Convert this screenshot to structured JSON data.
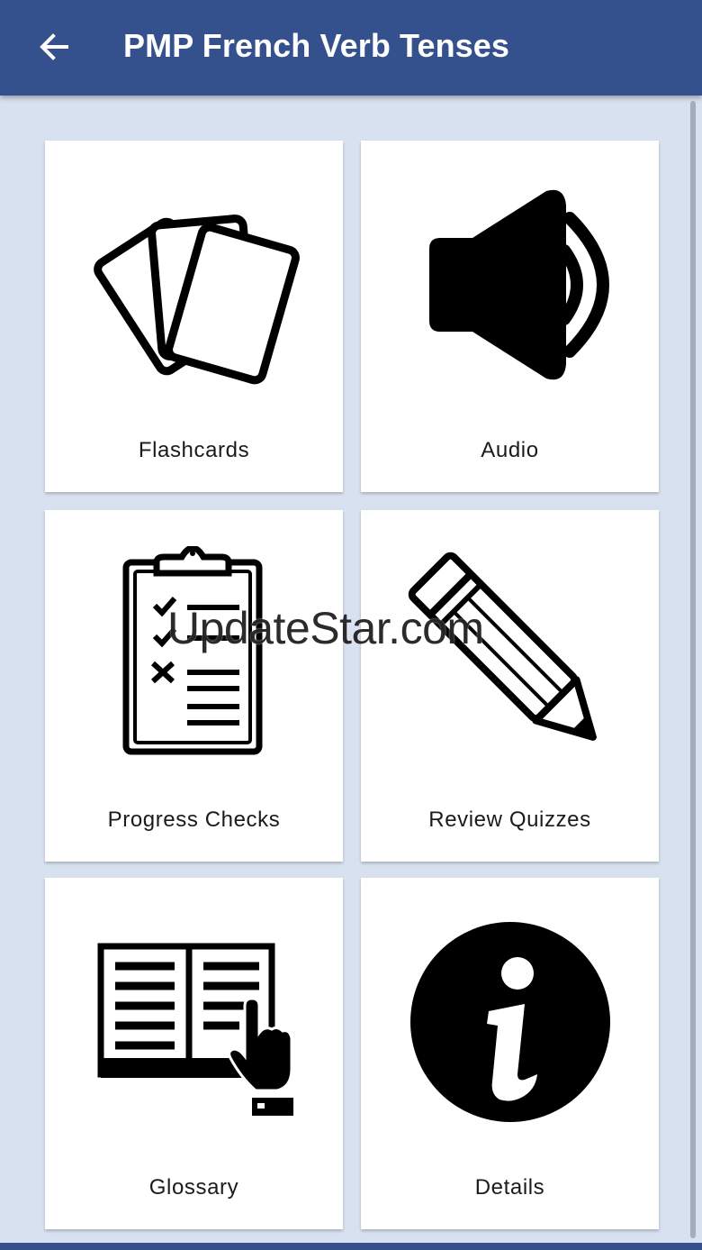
{
  "header": {
    "title": "PMP French Verb Tenses",
    "back_icon": "arrow-left-icon"
  },
  "menu": [
    {
      "label": "Flashcards",
      "icon": "flashcards-icon"
    },
    {
      "label": "Audio",
      "icon": "speaker-icon"
    },
    {
      "label": "Progress Checks",
      "icon": "clipboard-checklist-icon"
    },
    {
      "label": "Review Quizzes",
      "icon": "pencil-icon"
    },
    {
      "label": "Glossary",
      "icon": "open-book-pointer-icon"
    },
    {
      "label": "Details",
      "icon": "info-icon"
    }
  ],
  "watermark": "UpdateStar.com",
  "colors": {
    "app_bar": "#34508d",
    "background": "#d8e1f0",
    "card": "#ffffff",
    "icon": "#000000"
  }
}
